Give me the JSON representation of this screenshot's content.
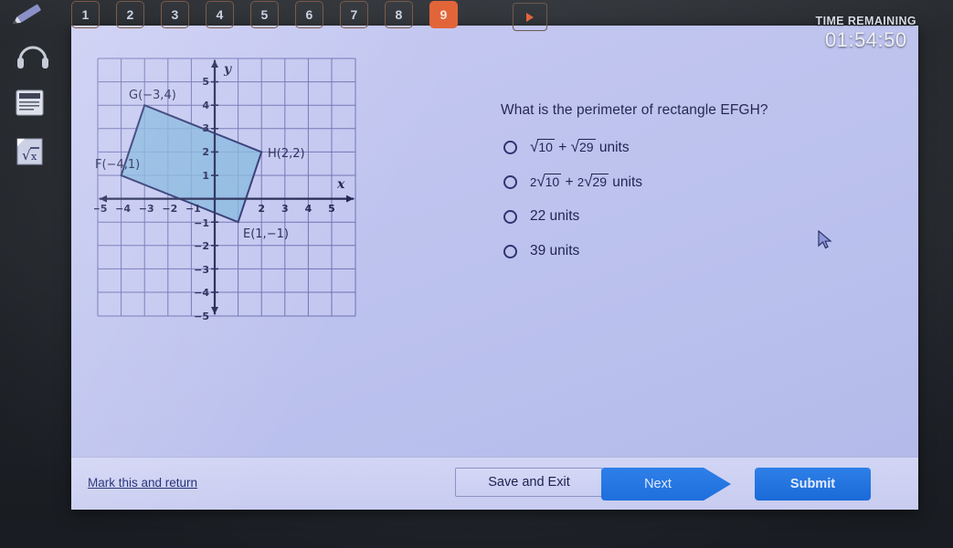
{
  "topbar": {
    "pencil_icon": "pencil-icon",
    "question_numbers": [
      "1",
      "2",
      "3",
      "4",
      "5",
      "6",
      "7",
      "8",
      "9"
    ],
    "active_number": "9",
    "next_arrow_icon": "play-arrow-icon"
  },
  "timer": {
    "label": "TIME REMAINING",
    "value": "01:54:50"
  },
  "rail": {
    "items": [
      {
        "icon": "headphones-icon"
      },
      {
        "icon": "calculator-icon"
      },
      {
        "icon": "square-root-formula-icon"
      }
    ]
  },
  "question": {
    "text": "What is the perimeter of rectangle EFGH?"
  },
  "options": [
    {
      "id": "a",
      "parts": [
        {
          "type": "sqrt",
          "coef": "",
          "radicand": "10"
        },
        {
          "type": "text",
          "value": " + "
        },
        {
          "type": "sqrt",
          "coef": "",
          "radicand": "29"
        },
        {
          "type": "text",
          "value": " units"
        }
      ],
      "plain": "√10 + √29 units",
      "selected": false
    },
    {
      "id": "b",
      "parts": [
        {
          "type": "sqrt",
          "coef": "2",
          "radicand": "10"
        },
        {
          "type": "text",
          "value": " + "
        },
        {
          "type": "sqrt",
          "coef": "2",
          "radicand": "29"
        },
        {
          "type": "text",
          "value": " units"
        }
      ],
      "plain": "2√10 + 2√29 units",
      "selected": false
    },
    {
      "id": "c",
      "parts": [
        {
          "type": "text",
          "value": "22 units"
        }
      ],
      "plain": "22 units",
      "selected": false
    },
    {
      "id": "d",
      "parts": [
        {
          "type": "text",
          "value": "39 units"
        }
      ],
      "plain": "39 units",
      "selected": false
    }
  ],
  "chart_data": {
    "type": "scatter",
    "title": "",
    "xlabel": "x",
    "ylabel": "y",
    "xlim": [
      -6,
      6
    ],
    "ylim": [
      -6,
      6
    ],
    "grid": true,
    "xticks": [
      -5,
      -4,
      -3,
      -2,
      -1,
      2,
      3,
      4,
      5
    ],
    "yticks": [
      5,
      4,
      3,
      2,
      1,
      -1,
      -2,
      -3,
      -4,
      -5
    ],
    "xtick_labels": [
      "-5",
      "-4",
      "-3",
      "-2",
      "-1",
      "2",
      "3",
      "4",
      "5"
    ],
    "ytick_labels": [
      "5",
      "4",
      "3",
      "2",
      "1",
      "-1",
      "-2",
      "-3",
      "-4",
      "-5"
    ],
    "shape": {
      "name": "EFGH",
      "fill": "#7fb4dd",
      "stroke": "#2a3270",
      "vertices": [
        {
          "label": "E",
          "x": 1,
          "y": -1,
          "annotation": "E(1,-1)"
        },
        {
          "label": "F",
          "x": -4,
          "y": 1,
          "annotation": "F(-4,1)"
        },
        {
          "label": "G",
          "x": -3,
          "y": 4,
          "annotation": "G(-3,4)"
        },
        {
          "label": "H",
          "x": 2,
          "y": 2,
          "annotation": "H(2,2)"
        }
      ]
    }
  },
  "bottombar": {
    "mark_link": "Mark this and return",
    "save_label": "Save and Exit",
    "next_label": "Next",
    "submit_label": "Submit"
  },
  "colors": {
    "accent_orange": "#e2653a",
    "button_blue": "#2f7fe8",
    "page_bg": "#bfc4ef",
    "shape_fill": "#7fb4dd",
    "shape_stroke": "#2a3270"
  }
}
